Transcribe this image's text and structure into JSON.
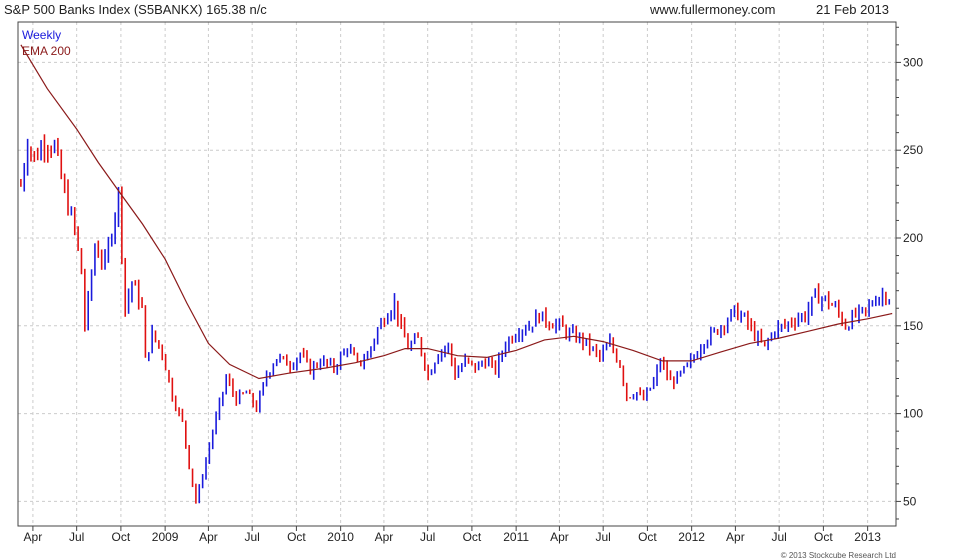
{
  "header": {
    "title": "S&P 500 Banks Index (S5BANKX) 165.38 n/c",
    "site": "www.fullermoney.com",
    "date": "21 Feb 2013"
  },
  "legend": {
    "weekly": "Weekly",
    "ema": "EMA 200"
  },
  "footer": {
    "copyright": "© 2013 Stockcube Research Ltd"
  },
  "colors": {
    "up": "#1a1adc",
    "down": "#e01010",
    "ema": "#8b1a1a",
    "grid": "#cccccc"
  },
  "chart_data": {
    "type": "candlestick",
    "title": "S&P 500 Banks Index (S5BANKX) 165.38 n/c",
    "frequency": "Weekly",
    "y_ticks": [
      50,
      100,
      150,
      200,
      250,
      300
    ],
    "ylim": [
      36,
      323
    ],
    "x_ticks": [
      "Apr",
      "Jul",
      "Oct",
      "2009",
      "Apr",
      "Jul",
      "Oct",
      "2010",
      "Apr",
      "Jul",
      "Oct",
      "2011",
      "Apr",
      "Jul",
      "Oct",
      "2012",
      "Apr",
      "Jul",
      "Oct",
      "2013"
    ],
    "x_tick_dates": [
      "2008-04",
      "2008-07",
      "2008-10",
      "2009-01",
      "2009-04",
      "2009-07",
      "2009-10",
      "2010-01",
      "2010-04",
      "2010-07",
      "2010-10",
      "2011-01",
      "2011-04",
      "2011-07",
      "2011-10",
      "2012-01",
      "2012-04",
      "2012-07",
      "2012-10",
      "2013-01"
    ],
    "xlim": [
      "2008-03-01",
      "2013-03-01"
    ],
    "close_path": [
      [
        "2008-03-07",
        230
      ],
      [
        "2008-03-21",
        255
      ],
      [
        "2008-04-04",
        245
      ],
      [
        "2008-04-25",
        255
      ],
      [
        "2008-05-16",
        252
      ],
      [
        "2008-06-06",
        225
      ],
      [
        "2008-06-27",
        205
      ],
      [
        "2008-07-11",
        180
      ],
      [
        "2008-07-18",
        150
      ],
      [
        "2008-08-08",
        195
      ],
      [
        "2008-08-29",
        185
      ],
      [
        "2008-09-19",
        215
      ],
      [
        "2008-09-26",
        225
      ],
      [
        "2008-10-10",
        160
      ],
      [
        "2008-10-24",
        175
      ],
      [
        "2008-11-14",
        160
      ],
      [
        "2008-11-21",
        130
      ],
      [
        "2008-12-05",
        145
      ],
      [
        "2008-12-26",
        135
      ],
      [
        "2009-01-16",
        110
      ],
      [
        "2009-02-06",
        95
      ],
      [
        "2009-02-20",
        70
      ],
      [
        "2009-03-06",
        50
      ],
      [
        "2009-03-20",
        65
      ],
      [
        "2009-04-10",
        90
      ],
      [
        "2009-05-08",
        120
      ],
      [
        "2009-05-29",
        108
      ],
      [
        "2009-06-19",
        112
      ],
      [
        "2009-07-10",
        103
      ],
      [
        "2009-07-31",
        122
      ],
      [
        "2009-08-21",
        132
      ],
      [
        "2009-09-18",
        128
      ],
      [
        "2009-10-09",
        134
      ],
      [
        "2009-10-30",
        125
      ],
      [
        "2009-11-20",
        130
      ],
      [
        "2009-12-18",
        126
      ],
      [
        "2010-01-15",
        138
      ],
      [
        "2010-02-05",
        128
      ],
      [
        "2010-02-26",
        133
      ],
      [
        "2010-03-19",
        148
      ],
      [
        "2010-04-09",
        158
      ],
      [
        "2010-04-23",
        163
      ],
      [
        "2010-05-07",
        148
      ],
      [
        "2010-05-21",
        138
      ],
      [
        "2010-06-11",
        142
      ],
      [
        "2010-07-02",
        122
      ],
      [
        "2010-07-23",
        135
      ],
      [
        "2010-08-13",
        138
      ],
      [
        "2010-08-27",
        122
      ],
      [
        "2010-09-17",
        130
      ],
      [
        "2010-10-08",
        126
      ],
      [
        "2010-10-29",
        130
      ],
      [
        "2010-11-19",
        125
      ],
      [
        "2010-12-10",
        140
      ],
      [
        "2011-01-07",
        148
      ],
      [
        "2011-01-28",
        150
      ],
      [
        "2011-02-18",
        156
      ],
      [
        "2011-03-11",
        152
      ],
      [
        "2011-04-01",
        150
      ],
      [
        "2011-04-22",
        145
      ],
      [
        "2011-05-13",
        143
      ],
      [
        "2011-06-03",
        138
      ],
      [
        "2011-06-24",
        132
      ],
      [
        "2011-07-15",
        140
      ],
      [
        "2011-08-05",
        128
      ],
      [
        "2011-08-19",
        110
      ],
      [
        "2011-09-09",
        112
      ],
      [
        "2011-09-23",
        108
      ],
      [
        "2011-10-14",
        118
      ],
      [
        "2011-10-28",
        130
      ],
      [
        "2011-11-18",
        118
      ],
      [
        "2011-12-09",
        122
      ],
      [
        "2012-01-06",
        132
      ],
      [
        "2012-01-27",
        142
      ],
      [
        "2012-02-17",
        146
      ],
      [
        "2012-03-09",
        152
      ],
      [
        "2012-03-30",
        158
      ],
      [
        "2012-04-20",
        154
      ],
      [
        "2012-05-18",
        142
      ],
      [
        "2012-06-01",
        138
      ],
      [
        "2012-06-22",
        148
      ],
      [
        "2012-07-13",
        150
      ],
      [
        "2012-08-03",
        154
      ],
      [
        "2012-08-24",
        156
      ],
      [
        "2012-09-14",
        167
      ],
      [
        "2012-10-05",
        165
      ],
      [
        "2012-10-26",
        160
      ],
      [
        "2012-11-16",
        150
      ],
      [
        "2012-12-07",
        156
      ],
      [
        "2012-12-28",
        158
      ],
      [
        "2013-01-18",
        166
      ],
      [
        "2013-02-08",
        168
      ],
      [
        "2013-02-21",
        165
      ]
    ],
    "ema_200": [
      [
        "2008-03-07",
        310
      ],
      [
        "2008-05-01",
        285
      ],
      [
        "2008-07-01",
        262
      ],
      [
        "2008-08-15",
        243
      ],
      [
        "2008-10-01",
        225
      ],
      [
        "2008-11-15",
        208
      ],
      [
        "2009-01-01",
        188
      ],
      [
        "2009-02-15",
        163
      ],
      [
        "2009-04-01",
        140
      ],
      [
        "2009-05-15",
        128
      ],
      [
        "2009-07-15",
        120
      ],
      [
        "2009-09-15",
        123
      ],
      [
        "2009-12-01",
        126
      ],
      [
        "2010-02-01",
        129
      ],
      [
        "2010-04-01",
        133
      ],
      [
        "2010-05-15",
        137
      ],
      [
        "2010-07-01",
        137
      ],
      [
        "2010-09-01",
        133
      ],
      [
        "2010-11-01",
        132
      ],
      [
        "2011-01-01",
        136
      ],
      [
        "2011-03-01",
        142
      ],
      [
        "2011-05-01",
        144
      ],
      [
        "2011-07-01",
        141
      ],
      [
        "2011-09-01",
        136
      ],
      [
        "2011-11-01",
        130
      ],
      [
        "2012-01-01",
        130
      ],
      [
        "2012-03-01",
        135
      ],
      [
        "2012-05-01",
        140
      ],
      [
        "2012-07-01",
        143
      ],
      [
        "2012-09-01",
        147
      ],
      [
        "2012-11-01",
        151
      ],
      [
        "2013-01-01",
        154
      ],
      [
        "2013-02-21",
        157
      ]
    ]
  }
}
